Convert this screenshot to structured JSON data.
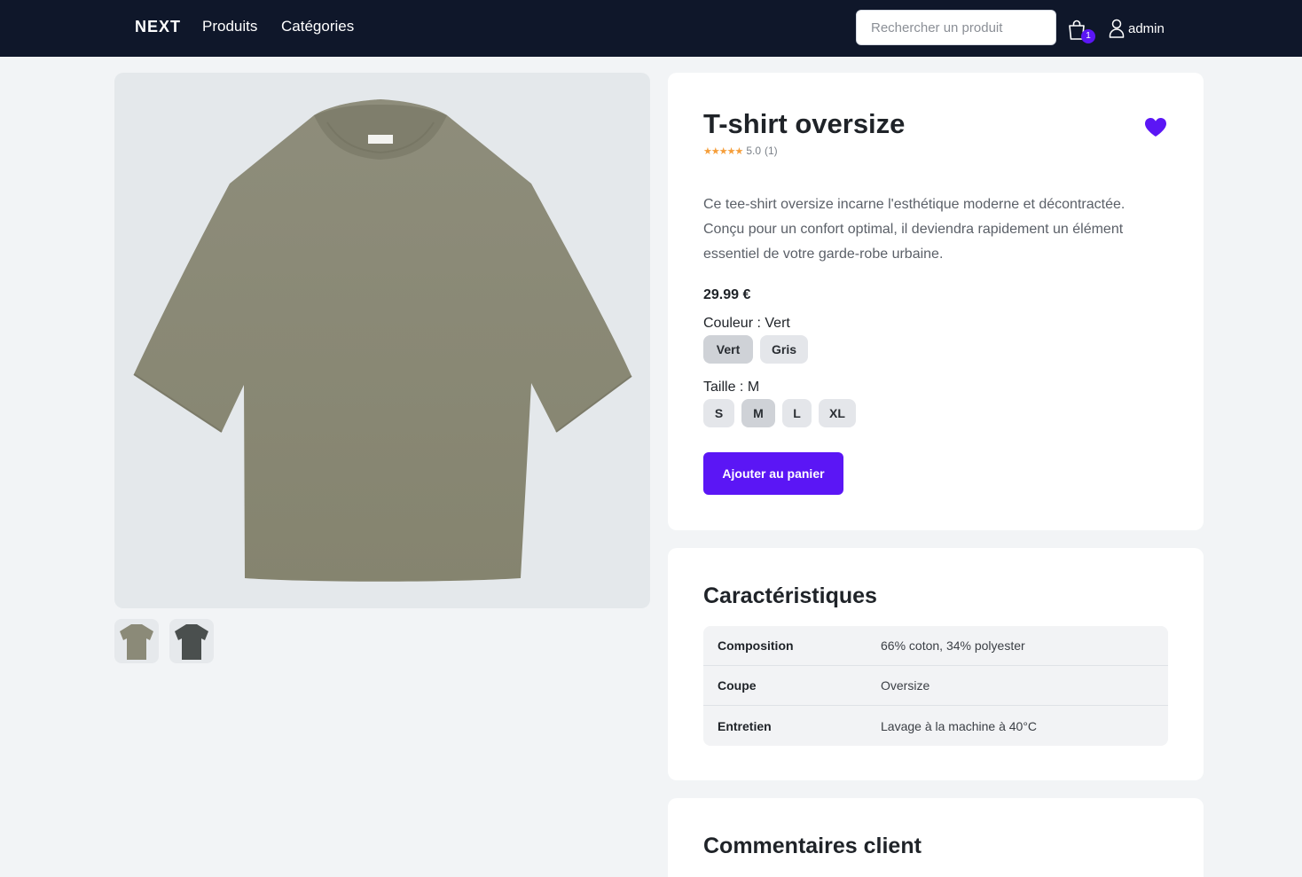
{
  "nav": {
    "logo": "NEXT",
    "links": [
      "Produits",
      "Catégories"
    ],
    "search_placeholder": "Rechercher un produit",
    "cart_count": "1",
    "user": "admin"
  },
  "product": {
    "title": "T-shirt oversize",
    "stars": "★★★★★",
    "rating": "5.0",
    "rating_count": "(1)",
    "description": "Ce tee-shirt oversize incarne l'esthétique moderne et décontractée. Conçu pour un confort optimal, il deviendra rapidement un élément essentiel de votre garde-robe urbaine.",
    "price": "29.99 €",
    "color_label": "Couleur :",
    "color_selected": "Vert",
    "colors": [
      "Vert",
      "Gris"
    ],
    "size_label": "Taille :",
    "size_selected": "M",
    "sizes": [
      "S",
      "M",
      "L",
      "XL"
    ],
    "add_to_cart": "Ajouter au panier",
    "favorite": true,
    "images": [
      {
        "color": "#8b8a78"
      },
      {
        "color": "#4a4f4e"
      }
    ]
  },
  "specs": {
    "title": "Caractéristiques",
    "rows": [
      {
        "key": "Composition",
        "value": "66% coton, 34% polyester"
      },
      {
        "key": "Coupe",
        "value": "Oversize"
      },
      {
        "key": "Entretien",
        "value": "Lavage à la machine à 40°C"
      }
    ]
  },
  "reviews": {
    "title": "Commentaires client"
  },
  "colors": {
    "nav_bg": "#0f172a",
    "accent": "#5b16f5",
    "star": "#f59e3a"
  }
}
